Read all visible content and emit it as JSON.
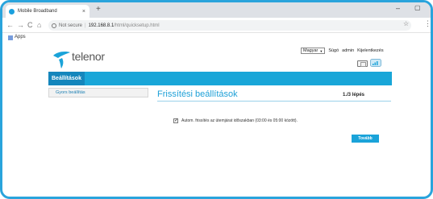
{
  "browser": {
    "tab_title": "Mobile Broadband",
    "tab_close": "×",
    "new_tab": "+",
    "window_minimize": "–",
    "window_maximize": "▢",
    "nav_back": "←",
    "nav_forward": "→",
    "nav_reload": "C",
    "nav_home": "⌂",
    "address": {
      "security_label": "Not secure",
      "separator": "|",
      "host": "192.168.8.1",
      "path": "/html/quicksetup.html"
    },
    "bookmark_star": "☆",
    "menu": "⋮",
    "bookmarks": {
      "apps_label": "Apps"
    }
  },
  "brand": {
    "logo_text": "telenor",
    "color_primary": "#1aa3d9"
  },
  "header_links": {
    "language_selected": "Magyar",
    "language_arrow": "▼",
    "help": "Súgó",
    "admin": "admin",
    "logout": "Kijelentkezés"
  },
  "nav": {
    "active_tab": "Beállítások"
  },
  "sidebar": {
    "items": [
      {
        "label": "Gyors beállítás"
      }
    ]
  },
  "main": {
    "title": "Frissítési beállítások",
    "step": "1./3 lépés",
    "auto_update": {
      "checked": true,
      "label": "Autom. frissítés az ütemjárat időszakban (03:00 és 05:00 között)."
    },
    "next_button": "Tovább"
  }
}
